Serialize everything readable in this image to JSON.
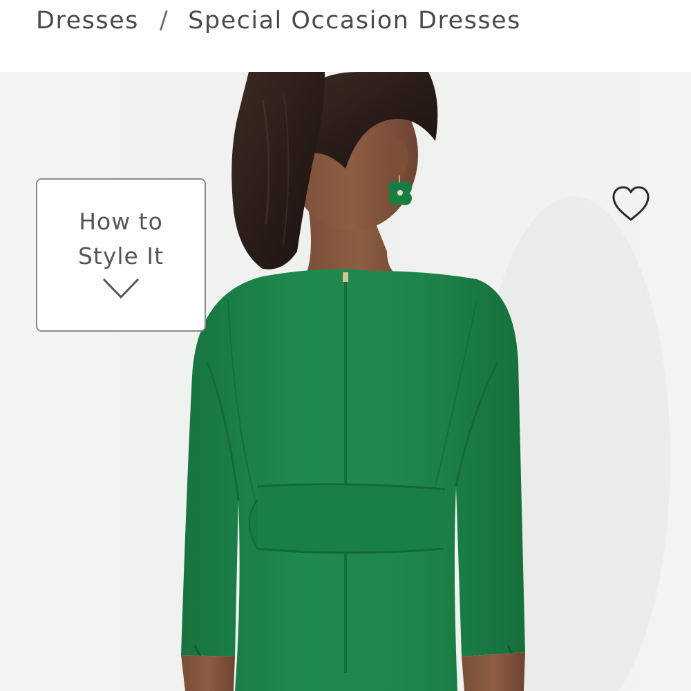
{
  "breadcrumb": {
    "items": [
      {
        "label": "Dresses"
      },
      {
        "label": "Special Occasion Dresses"
      }
    ],
    "separator": "/"
  },
  "product": {
    "dress_color": "#1f8a4f",
    "background_color": "#f2f3f2"
  },
  "style_guide": {
    "label": "How to Style It",
    "icon": "chevron-down-icon"
  },
  "wishlist": {
    "icon": "heart-icon"
  }
}
